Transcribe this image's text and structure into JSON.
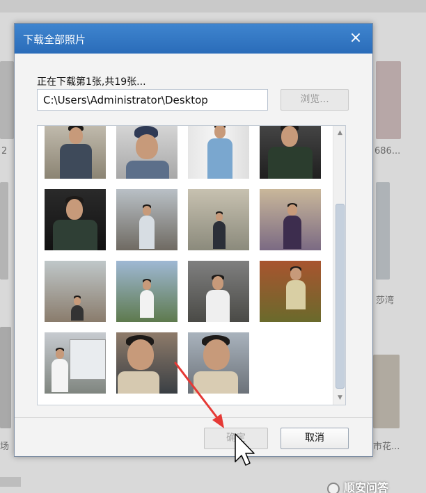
{
  "dialog": {
    "title": "下载全部照片",
    "close_icon": "×",
    "status": "正在下载第1张,共19张...",
    "path_value": "C:\\Users\\Administrator\\Desktop",
    "browse_label": "浏览...",
    "ok_label": "确定",
    "cancel_label": "取消"
  },
  "background": {
    "labels": [
      "2",
      "686...",
      "莎湾",
      "场",
      "市花..."
    ]
  },
  "watermark": {
    "text": "顺安问答"
  },
  "icons": {
    "close": "close-icon",
    "scroll_up": "scroll-up-icon",
    "scroll_down": "scroll-down-icon",
    "cursor": "mouse-cursor-icon",
    "arrow": "red-pointer-arrow"
  },
  "colors": {
    "titlebar": "#2f78c4",
    "annotation_arrow": "#e53935"
  }
}
